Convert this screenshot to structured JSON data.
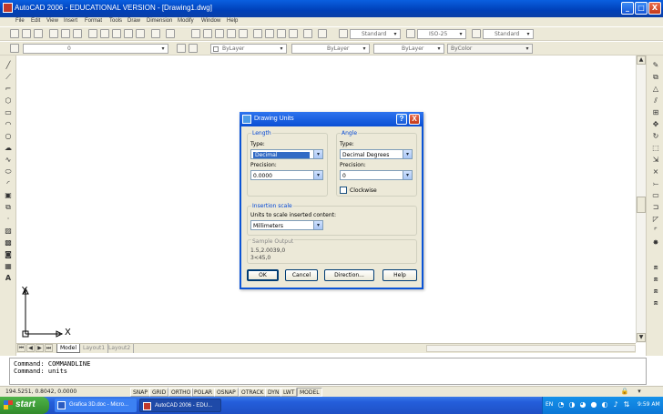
{
  "app": {
    "title": "AutoCAD 2006 - EDUCATIONAL VERSION - [Drawing1.dwg]",
    "window_buttons": [
      "_",
      "□",
      "X"
    ]
  },
  "menu": [
    "File",
    "Edit",
    "View",
    "Insert",
    "Format",
    "Tools",
    "Draw",
    "Dimension",
    "Modify",
    "Window",
    "Help"
  ],
  "toolbar": {
    "text_style": "Standard",
    "dim_style": "ISO-25",
    "table_style": "Standard",
    "layer": "0",
    "color": "ByLayer",
    "linetype": "ByLayer",
    "lineweight": "ByLayer",
    "plotstyle": "ByColor"
  },
  "ucs": {
    "x": "X",
    "y": "Y"
  },
  "layout_tabs": [
    "Model",
    "Layout1",
    "Layout2"
  ],
  "command_lines": [
    "Command: COMMANDLINE",
    "Command: units"
  ],
  "status": {
    "coords": "194.5251, 0.8042, 0.0000",
    "buttons": [
      "SNAP",
      "GRID",
      "ORTHO",
      "POLAR",
      "OSNAP",
      "OTRACK",
      "DYN",
      "LWT",
      "MODEL"
    ]
  },
  "taskbar": {
    "start": "start",
    "tasks": [
      "Grafica 3D.doc - Micro...",
      "AutoCAD 2006 - EDU..."
    ],
    "lang": "EN",
    "time": "9:59 AM"
  },
  "dialog": {
    "title": "Drawing Units",
    "help_glyph": "?",
    "close_glyph": "X",
    "length": {
      "group": "Length",
      "type_label": "Type:",
      "type_value": "Decimal",
      "precision_label": "Precision:",
      "precision_value": "0.0000"
    },
    "angle": {
      "group": "Angle",
      "type_label": "Type:",
      "type_value": "Decimal Degrees",
      "precision_label": "Precision:",
      "precision_value": "0",
      "clockwise_label": "Clockwise"
    },
    "insertion": {
      "group": "Insertion scale",
      "label": "Units to scale inserted content:",
      "value": "Millimeters"
    },
    "sample": {
      "group": "Sample Output",
      "line1": "1.5,2.0039,0",
      "line2": "3<45,0"
    },
    "buttons": {
      "ok": "OK",
      "cancel": "Cancel",
      "direction": "Direction...",
      "help": "Help"
    }
  },
  "colors": {
    "title_blue": "#0a4fd4",
    "face": "#ece9d8",
    "highlight": "#316ac5",
    "taskbar": "#245edb",
    "start_green": "#3c9e37"
  }
}
